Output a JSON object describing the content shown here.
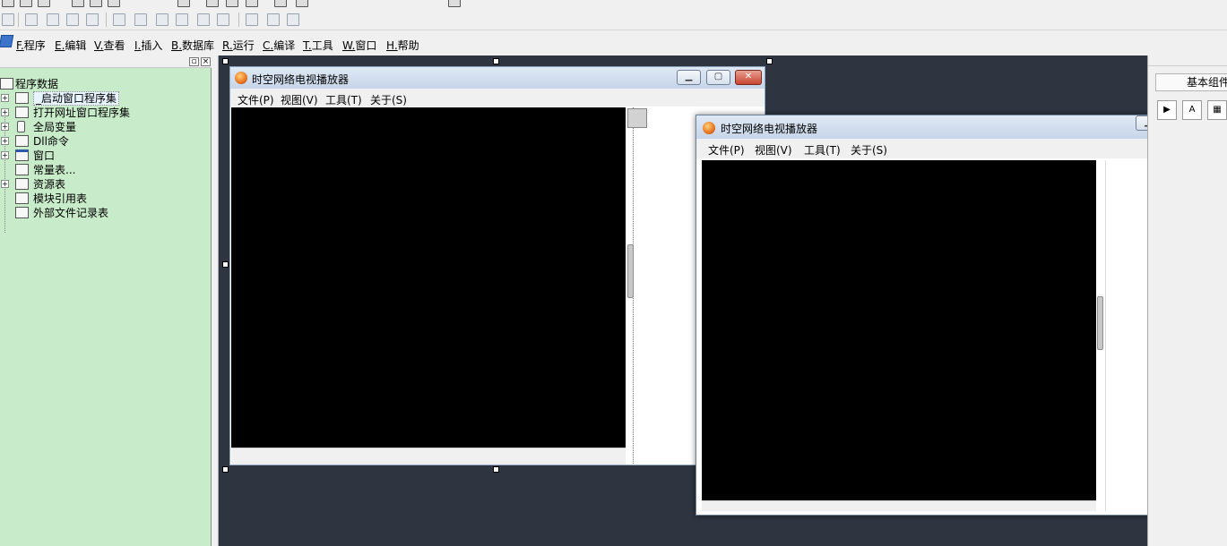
{
  "menubar": {
    "items": [
      "F.程序",
      "E.编辑",
      "V.查看",
      "I.插入",
      "B.数据库",
      "R.运行",
      "C.编译",
      "T.工具",
      "W.窗口",
      "H.帮助"
    ]
  },
  "left_panel": {
    "root": "程序数据",
    "items": [
      "_启动窗口程序集",
      "打开网址窗口程序集",
      "全局变量",
      "Dll命令",
      "窗口",
      "常量表...",
      "资源表",
      "模块引用表",
      "外部文件记录表"
    ]
  },
  "window_design": {
    "title": "时空网络电视播放器",
    "menu": [
      "文件(P)",
      "视图(V)",
      "工具(T)",
      "关于(S)"
    ]
  },
  "window_running": {
    "title": "时空网络电视播放器",
    "menu": [
      "文件(P)",
      "视图(V)",
      "工具(T)",
      "关于(S)"
    ]
  },
  "right_panel": {
    "title": "基本组件"
  },
  "colors": {
    "workspace": "#2e3440",
    "left_panel": "#c8ebc9",
    "video": "#000000"
  }
}
